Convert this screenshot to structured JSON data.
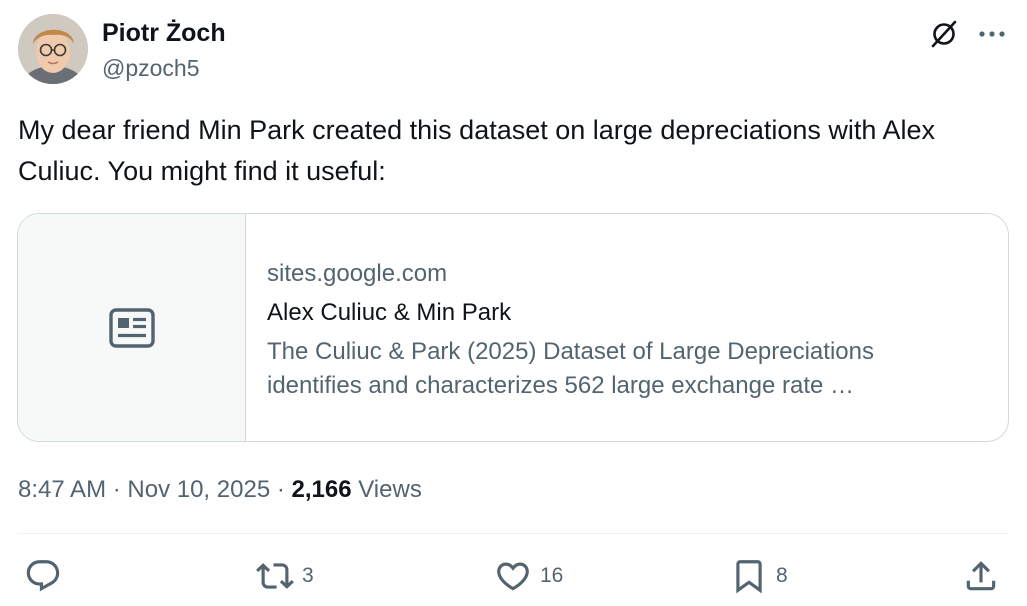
{
  "author": {
    "name": "Piotr Żoch",
    "handle": "@pzoch5"
  },
  "tweet": {
    "text": "My dear friend Min Park created this dataset on large depreciations with Alex Culiuc. You might find it useful:"
  },
  "card": {
    "domain": "sites.google.com",
    "title": "Alex Culiuc & Min Park",
    "description": "The Culiuc & Park (2025) Dataset of Large Depreciations identifies and characterizes 562 large exchange rate …",
    "thumbnail_icon": "article-icon"
  },
  "meta": {
    "time": "8:47 AM",
    "date": "Nov 10, 2025",
    "separator": " · ",
    "views_count": "2,166",
    "views_label": "Views"
  },
  "actions": {
    "reply_count": "",
    "retweet_count": "3",
    "like_count": "16",
    "bookmark_count": "8"
  },
  "icons": {
    "header": [
      "grok-icon",
      "more-icon"
    ],
    "actions": [
      "reply-icon",
      "retweet-icon",
      "like-icon",
      "bookmark-icon",
      "share-icon"
    ]
  },
  "colors": {
    "text_primary": "#0f1419",
    "text_secondary": "#536471",
    "border": "#cfd9de",
    "card_thumb_bg": "#f7f9f9"
  }
}
